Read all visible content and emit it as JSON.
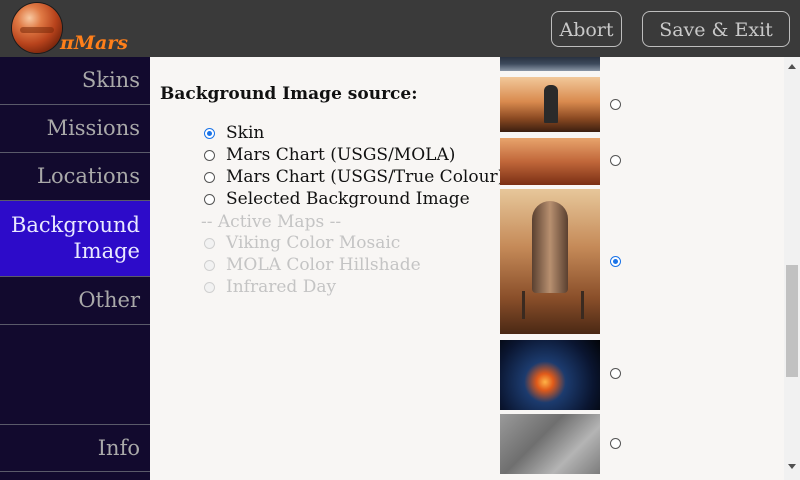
{
  "app": {
    "logo_text": "πMars",
    "abort_label": "Abort",
    "save_exit_label": "Save & Exit"
  },
  "sidebar": {
    "items": [
      {
        "label": "Skins",
        "active": false
      },
      {
        "label": "Missions",
        "active": false
      },
      {
        "label": "Locations",
        "active": false
      },
      {
        "label_line1": "Background",
        "label_line2": "Image",
        "active": true
      },
      {
        "label": "Other",
        "active": false
      }
    ],
    "info_label": "Info"
  },
  "main": {
    "section_title": "Background Image source:",
    "options": [
      {
        "label": "Skin",
        "checked": true,
        "disabled": false
      },
      {
        "label": "Mars Chart (USGS/MOLA)",
        "checked": false,
        "disabled": false
      },
      {
        "label": "Mars Chart (USGS/True Colour)",
        "checked": false,
        "disabled": false
      },
      {
        "label": "Selected Background Image",
        "checked": false,
        "disabled": false
      }
    ],
    "active_maps_label": "-- Active Maps --",
    "active_maps": [
      {
        "label": "Viking Color Mosaic",
        "disabled": true
      },
      {
        "label": "MOLA Color Hillshade",
        "disabled": true
      },
      {
        "label": "Infrared Day",
        "disabled": true
      }
    ],
    "thumbnails": [
      {
        "subject": "moon-surface",
        "checked": false
      },
      {
        "subject": "rocket-on-mars",
        "checked": false
      },
      {
        "subject": "astronaut-on-mars",
        "checked": false
      },
      {
        "subject": "mars-lander",
        "checked": true
      },
      {
        "subject": "asteroid-impact",
        "checked": false
      },
      {
        "subject": "grey-crater-terrain",
        "checked": false
      }
    ]
  },
  "colors": {
    "sidebar_bg": "#120a2e",
    "sidebar_active": "#2d0bc9",
    "header_bg": "#3a3a3a",
    "logo_accent": "#ff7f1a",
    "radio_checked": "#1a73e8"
  }
}
